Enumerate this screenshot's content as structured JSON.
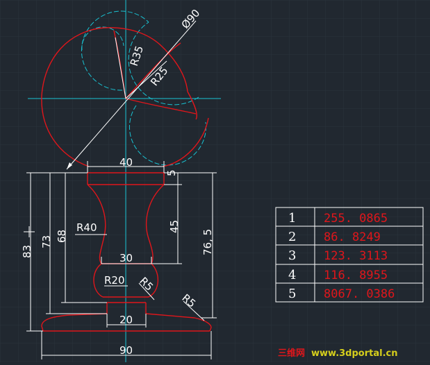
{
  "colors": {
    "background": "#212830",
    "grid": "#2b333d",
    "outline": "#e0161b",
    "construction": "#19c3d3",
    "dimension": "#ffffff",
    "table_value": "#e0161b",
    "watermark_cn": "#e0161b",
    "watermark_url": "#d6cf1c"
  },
  "dimensions": {
    "diameter": "Ø90",
    "r35": "R35",
    "r25": "R25",
    "w40": "40",
    "h5": "5",
    "r40": "R40",
    "h45": "45",
    "w30": "30",
    "r20": "R20",
    "r5_inner": "R5",
    "r5_outer": "R5",
    "w20": "20",
    "w90": "90",
    "h83": "83",
    "h73": "73",
    "h68": "68",
    "h765": "76, 5"
  },
  "table": {
    "rows": [
      {
        "index": "1",
        "value": "255. 0865"
      },
      {
        "index": "2",
        "value": "86. 8249"
      },
      {
        "index": "3",
        "value": "123. 3113"
      },
      {
        "index": "4",
        "value": "116. 8955"
      },
      {
        "index": "5",
        "value": "8067. 0386"
      }
    ]
  },
  "watermark": {
    "cn": "三维网",
    "url": "www.3dportal.cn"
  }
}
